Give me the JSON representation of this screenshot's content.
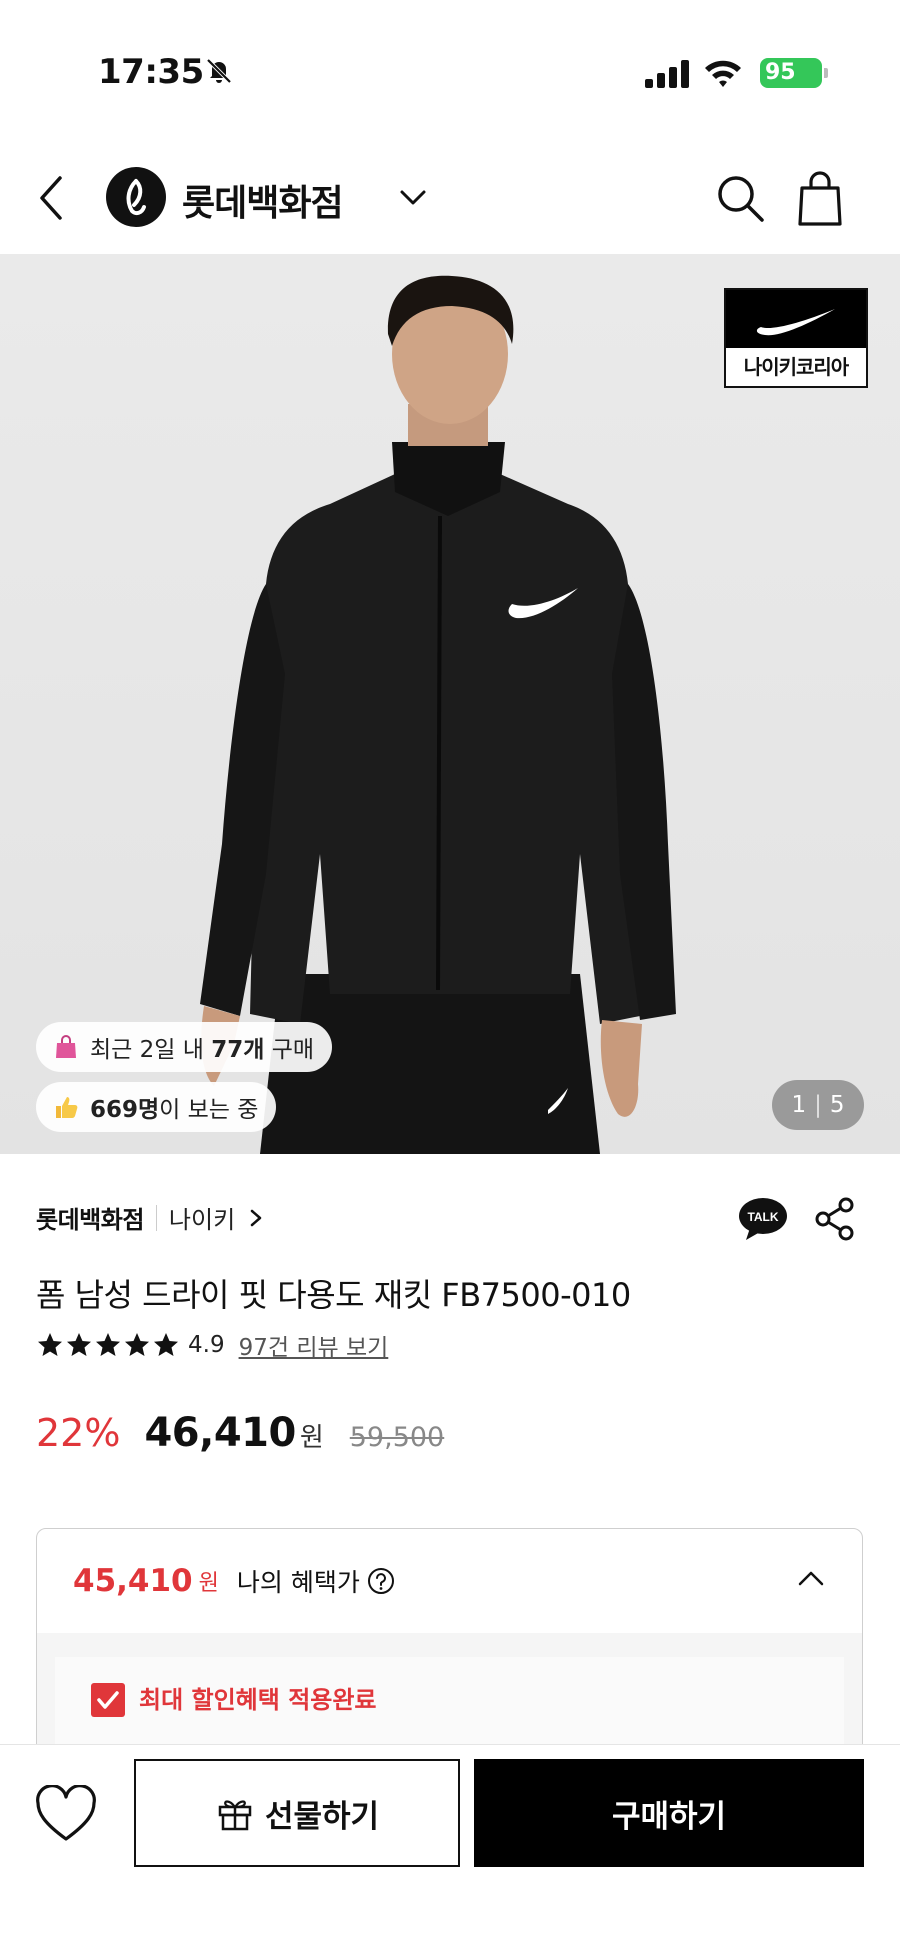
{
  "status": {
    "time": "17:35",
    "battery": "95"
  },
  "header": {
    "store_name": "롯데백화점"
  },
  "image": {
    "brand_badge": "나이키코리아",
    "recent_purchase": {
      "prefix": "최근 2일 내 ",
      "count": "77개",
      "suffix": " 구매"
    },
    "viewers": {
      "count": "669명",
      "suffix": "이 보는 중"
    },
    "counter": {
      "current": "1",
      "total": "5"
    }
  },
  "product": {
    "seller": "롯데백화점",
    "brand": "나이키",
    "title": "폼 남성 드라이 핏 다용도 재킷 FB7500-010",
    "rating": "4.9",
    "stars": 5,
    "review_link": "97건 리뷰 보기",
    "discount": "22%",
    "sale_price": "46,410",
    "won": "원",
    "original_price": "59,500"
  },
  "benefit": {
    "price": "45,410",
    "won": "원",
    "label": "나의 혜택가",
    "applied_label": "최대 할인혜택 적용완료"
  },
  "bottom": {
    "gift_label": "선물하기",
    "buy_label": "구매하기"
  },
  "colors": {
    "accent_red": "#e0363a",
    "black": "#000000"
  }
}
